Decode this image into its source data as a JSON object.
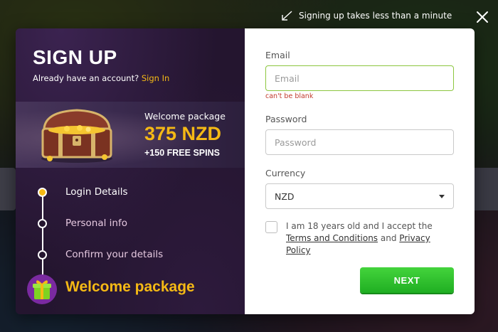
{
  "hint": {
    "text": "Signing up takes less than a minute",
    "icon": "arrow-icon"
  },
  "close": {
    "icon": "close-icon"
  },
  "left": {
    "title": "SIGN UP",
    "account_prompt": "Already have an account?",
    "signin_label": "Sign In",
    "banner": {
      "label": "Welcome package",
      "amount": "375 NZD",
      "spins": "+150 FREE SPINS"
    },
    "steps": [
      {
        "label": "Login Details",
        "active": true
      },
      {
        "label": "Personal info",
        "active": false
      },
      {
        "label": "Confirm your details",
        "active": false
      }
    ],
    "final_step": "Welcome package"
  },
  "form": {
    "email": {
      "label": "Email",
      "placeholder": "Email",
      "value": "",
      "error": "can't be blank"
    },
    "password": {
      "label": "Password",
      "placeholder": "Password",
      "value": ""
    },
    "currency": {
      "label": "Currency",
      "selected": "NZD"
    },
    "terms": {
      "checked": false,
      "prefix": "I am 18 years old and I accept the",
      "terms_link": "Terms and Conditions",
      "conjunction": "and",
      "privacy_link": "Privacy Policy"
    },
    "next_label": "NEXT"
  },
  "colors": {
    "accent": "#f5b915",
    "button_green": "#2cc22d",
    "panel_purple": "#24152f",
    "error": "#c0392b",
    "focus_border": "#8cc63f"
  }
}
